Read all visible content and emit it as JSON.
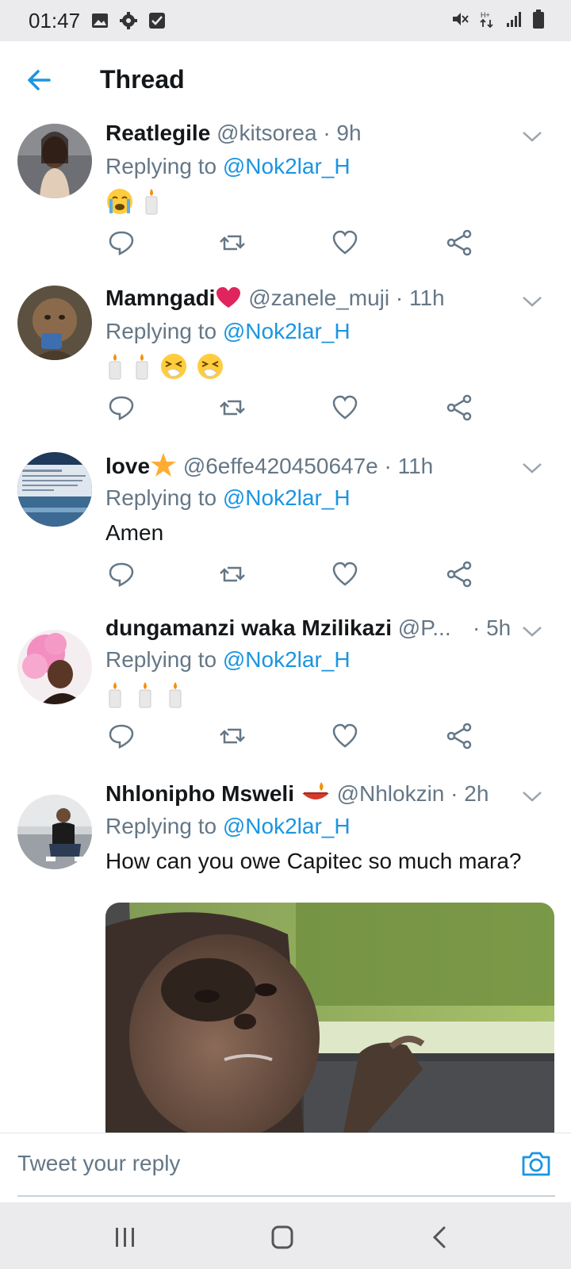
{
  "status_bar": {
    "time": "01:47"
  },
  "header": {
    "title": "Thread"
  },
  "tweets": [
    {
      "name": "Reatlegile",
      "handle": "@kitsorea",
      "time": "· 9h",
      "replying_prefix": "Replying to",
      "replying_to": "@Nok2lar_H",
      "body_emoji": [
        "loudly-crying-face",
        "candle"
      ]
    },
    {
      "name": "Mamngadi",
      "name_emoji": "red-heart",
      "handle": "@zanele_muji",
      "time": "· 11h",
      "replying_prefix": "Replying to",
      "replying_to": "@Nok2lar_H",
      "body_emoji": [
        "candle",
        "candle",
        "sneezing-face",
        "sneezing-face"
      ]
    },
    {
      "name": "love",
      "name_emoji": "star",
      "handle": "@6effe420450647e",
      "time": "· 11h",
      "replying_prefix": "Replying to",
      "replying_to": "@Nok2lar_H",
      "body": "Amen"
    },
    {
      "name": "dungamanzi waka Mzilikazi",
      "handle": "@P...",
      "time": "· 5h",
      "replying_prefix": "Replying to",
      "replying_to": "@Nok2lar_H",
      "body_emoji": [
        "candle",
        "candle",
        "candle"
      ]
    },
    {
      "name": "Nhlonipho Msweli",
      "name_emoji": "diya-lamp",
      "handle": "@Nhlokzin",
      "time": "· 2h",
      "replying_prefix": "Replying to",
      "replying_to": "@Nok2lar_H",
      "body": "How can you owe Capitec so much mara?",
      "media": "monkey-photo"
    }
  ],
  "reply_bar": {
    "placeholder": "Tweet your reply"
  },
  "colors": {
    "accent": "#1b95e0",
    "secondary_text": "#657786",
    "divider": "#dfe3e6"
  }
}
